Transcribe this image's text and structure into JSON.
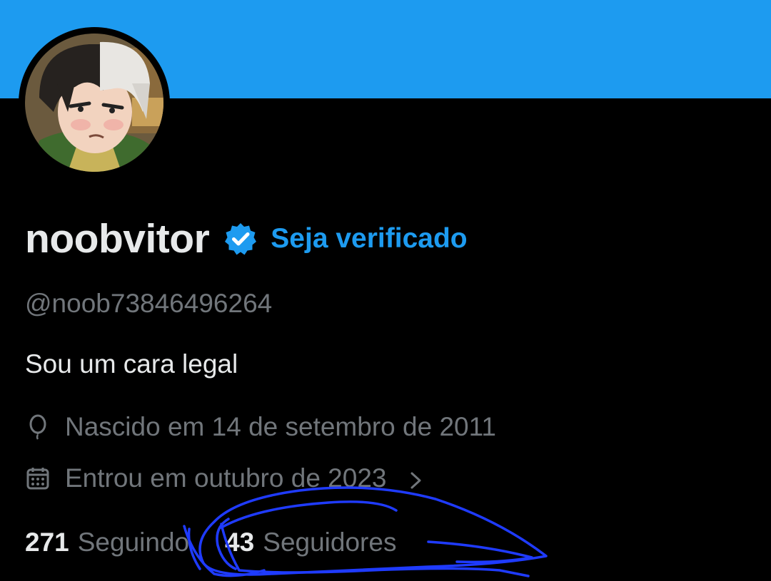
{
  "colors": {
    "accent": "#1d9bf0",
    "banner": "#1d9bf0",
    "background": "#000000",
    "primary_text": "#e7e9ea",
    "secondary_text": "#71767b",
    "scribble": "#1f3bff"
  },
  "profile": {
    "display_name": "noobvitor",
    "verified_icon": "verified-badge-icon",
    "verify_link": "Seja verificado",
    "handle": "@noob73846496264",
    "bio": "Sou um cara legal"
  },
  "meta": {
    "birth": {
      "icon": "balloon-icon",
      "text": "Nascido em 14 de setembro de 2011"
    },
    "joined": {
      "icon": "calendar-icon",
      "text": "Entrou em outubro de 2023",
      "chevron": "chevron-right-icon"
    }
  },
  "stats": {
    "following": {
      "count": "271",
      "label": "Seguindo"
    },
    "followers": {
      "count": "43",
      "label": "Seguidores"
    }
  }
}
